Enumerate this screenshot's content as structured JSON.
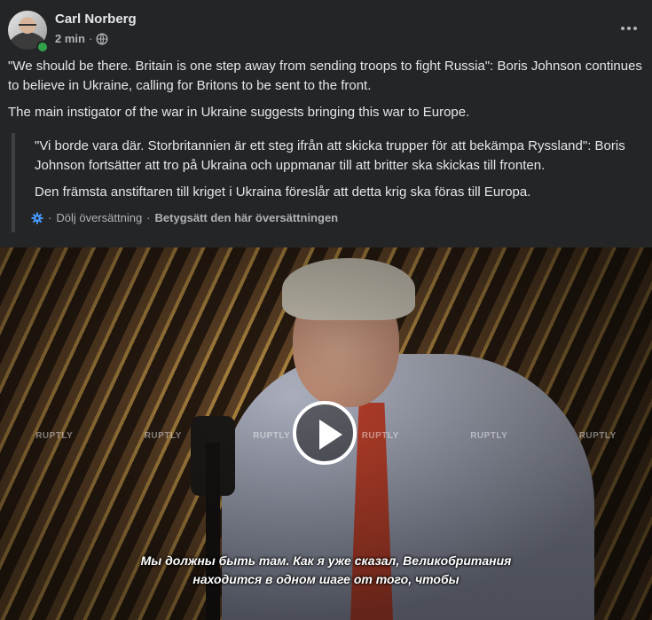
{
  "post": {
    "author": "Carl Norberg",
    "time": "2 min",
    "separator": "·",
    "text_paragraphs": [
      "\"We should be there. Britain is one step away from sending troops to fight Russia\": Boris Johnson continues to believe in Ukraine, calling for Britons to be sent to the front.",
      "The main instigator of the war in Ukraine suggests bringing this war to Europe."
    ],
    "translation": {
      "paragraphs": [
        "\"Vi borde vara där. Storbritannien är ett steg ifrån att skicka trupper för att bekämpa Ryssland\": Boris Johnson fortsätter att tro på Ukraina och uppmanar till att britter ska skickas till fronten.",
        "Den främsta anstiftaren till kriget i Ukraina föreslår att detta krig ska föras till Europa."
      ],
      "hide_label": "Dölj översättning",
      "rate_label": "Betygsätt den här översättningen",
      "separator": "·"
    }
  },
  "video": {
    "watermarks": [
      "RUPTLY",
      "RUPTLY",
      "RUPTLY",
      "RUPTLY",
      "RUPTLY",
      "RUPTLY"
    ],
    "subtitle_lines": [
      "Мы должны быть там. Как я уже сказал, Великобритания",
      "находится в одном шаге от того, чтобы"
    ]
  },
  "icons": {
    "privacy": "globe-icon",
    "menu": "more-icon",
    "translation": "gear-icon",
    "video": "play-icon"
  },
  "colors": {
    "background": "#242526",
    "online": "#31a24c",
    "translate_icon": "#4599ff"
  }
}
